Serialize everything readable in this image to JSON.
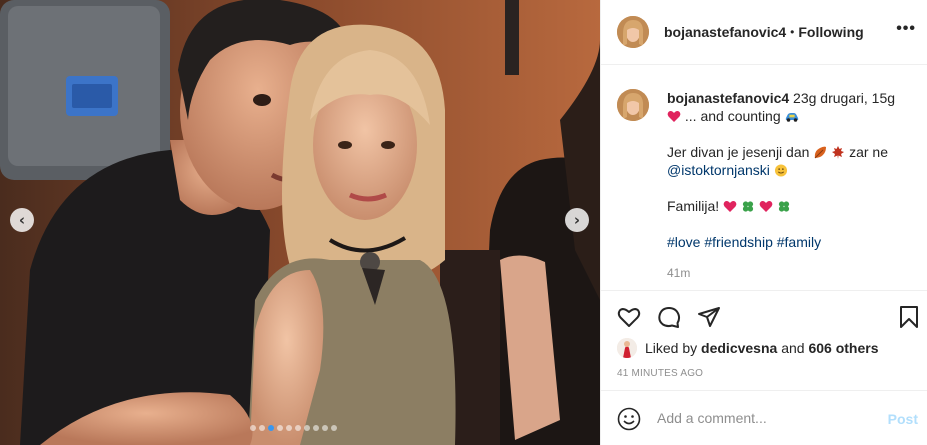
{
  "header": {
    "username": "bojanastefanovic4",
    "separator": "•",
    "follow_status": "Following",
    "more_label": "•••"
  },
  "photo": {
    "prev_label": "‹",
    "next_label": "›",
    "slide_count": 10,
    "active_slide": 2
  },
  "caption": {
    "username": "bojanastefanovic4",
    "line1_a": "23g drugari, 15g",
    "line1_b": "... and counting",
    "line2_a": "Jer divan je jesenji dan",
    "line2_b": "zar ne",
    "mention": "@istoktornjanski",
    "line3": "Familija!",
    "hashtags": [
      "#love",
      "#friendship",
      "#family"
    ],
    "time": "41m"
  },
  "likes": {
    "prefix": "Liked by",
    "user": "dedicvesna",
    "conj": "and",
    "others": "606 others"
  },
  "timestamp": "41 MINUTES AGO",
  "comment": {
    "placeholder": "Add a comment...",
    "post_label": "Post"
  },
  "colors": {
    "link": "#00376b",
    "post_button_disabled": "#b2dffc",
    "active_dot": "#3897f0",
    "border": "#efefef"
  },
  "icons": [
    "heart-icon",
    "comment-icon",
    "share-icon",
    "bookmark-icon",
    "smiley-icon",
    "chevron-left-icon",
    "chevron-right-icon"
  ]
}
